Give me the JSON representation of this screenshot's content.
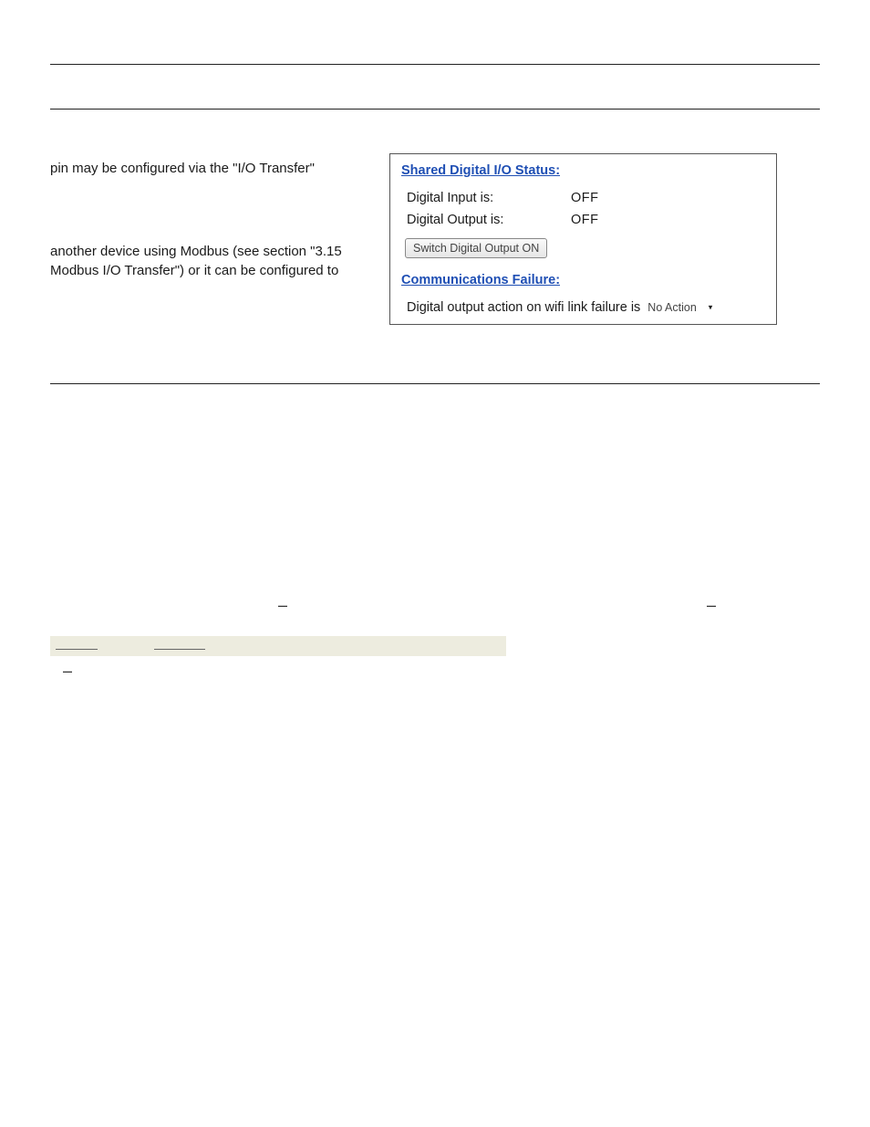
{
  "left": {
    "p1": "pin may be configured via the \"I/O Transfer\"",
    "p2": "another device using Modbus (see section \"3.15 Modbus I/O Transfer\") or it can be configured to"
  },
  "panel": {
    "status_heading": "Shared Digital I/O Status:",
    "di_label": "Digital Input is:",
    "di_value": "OFF",
    "do_label": "Digital Output is:",
    "do_value": "OFF",
    "button_label": "Switch Digital Output ON",
    "comm_heading": "Communications Failure:",
    "action_label": "Digital output action on wifi link failure is",
    "select_value": "No Action"
  },
  "glyphs": {
    "dash": "–",
    "caret": "▾"
  }
}
